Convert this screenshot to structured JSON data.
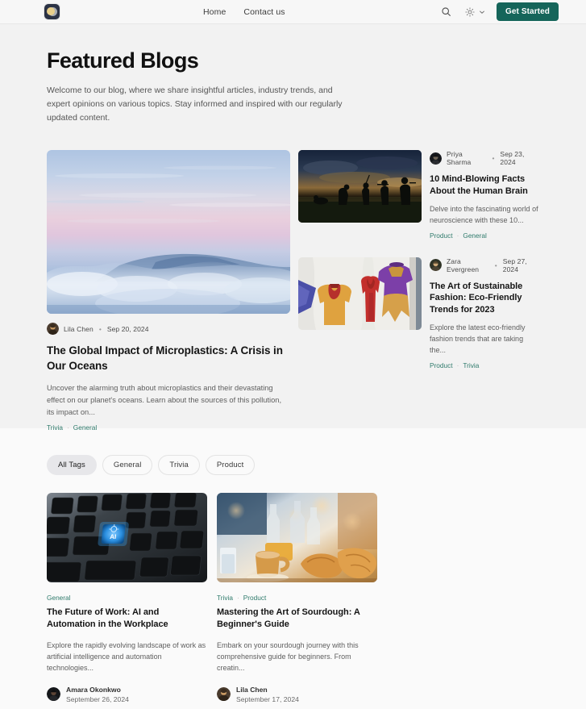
{
  "header": {
    "logo_icon": "moon-logo-icon",
    "nav": [
      {
        "label": "Home"
      },
      {
        "label": "Contact us"
      }
    ],
    "search_icon": "search-icon",
    "theme_icon": "sun-icon",
    "theme_chevron_icon": "chevron-down-icon",
    "cta_label": "Get Started",
    "accent_color": "#15655a"
  },
  "hero": {
    "title": "Featured Blogs",
    "subtitle": "Welcome to our blog, where we share insightful articles, industry trends, and expert opinions on various topics. Stay informed and inspired with our regularly updated content."
  },
  "featured": {
    "main": {
      "image_alt": "pastel-sunset-above-clouds",
      "author": "Lila Chen",
      "separator": "•",
      "date": "Sep 20, 2024",
      "title": "The Global Impact of Microplastics: A Crisis in Our Oceans",
      "description": "Uncover the alarming truth about microplastics and their devastating effect on our planet's oceans. Learn about the sources of this pollution, its impact on...",
      "tags": [
        "Trivia",
        "General"
      ],
      "tag_separator": "·"
    },
    "side": [
      {
        "image_alt": "human-evolution-silhouettes-at-sunset",
        "author": "Priya Sharma",
        "separator": "•",
        "date": "Sep 23, 2024",
        "title": "10 Mind-Blowing Facts About the Human Brain",
        "description": "Delve into the fascinating world of neuroscience with these 10...",
        "tags": [
          "Product",
          "General"
        ],
        "tag_separator": "·"
      },
      {
        "image_alt": "colorful-jackets-on-white-fabric",
        "author": "Zara Evergreen",
        "separator": "•",
        "date": "Sep 27, 2024",
        "title": "The Art of Sustainable Fashion: Eco-Friendly Trends for 2023",
        "description": "Explore the latest eco-friendly fashion trends that are taking the...",
        "tags": [
          "Product",
          "Trivia"
        ],
        "tag_separator": "·"
      }
    ]
  },
  "filters": {
    "items": [
      {
        "label": "All Tags",
        "active": true
      },
      {
        "label": "General",
        "active": false
      },
      {
        "label": "Trivia",
        "active": false
      },
      {
        "label": "Product",
        "active": false
      }
    ]
  },
  "posts": [
    {
      "image_alt": "keyboard-with-glowing-blue-ai-key",
      "tags": [
        "General"
      ],
      "tag_separator": "·",
      "title": "The Future of Work: AI and Automation in the Workplace",
      "description": "Explore the rapidly evolving landscape of work as artificial intelligence and automation technologies...",
      "author": "Amara Okonkwo",
      "date": "September 26, 2024"
    },
    {
      "image_alt": "coffee-cup-and-croissants-in-bakery",
      "tags": [
        "Trivia",
        "Product"
      ],
      "tag_separator": "·",
      "title": "Mastering the Art of Sourdough: A Beginner's Guide",
      "description": "Embark on your sourdough journey with this comprehensive guide for beginners. From creatin...",
      "author": "Lila Chen",
      "date": "September 17, 2024"
    }
  ]
}
